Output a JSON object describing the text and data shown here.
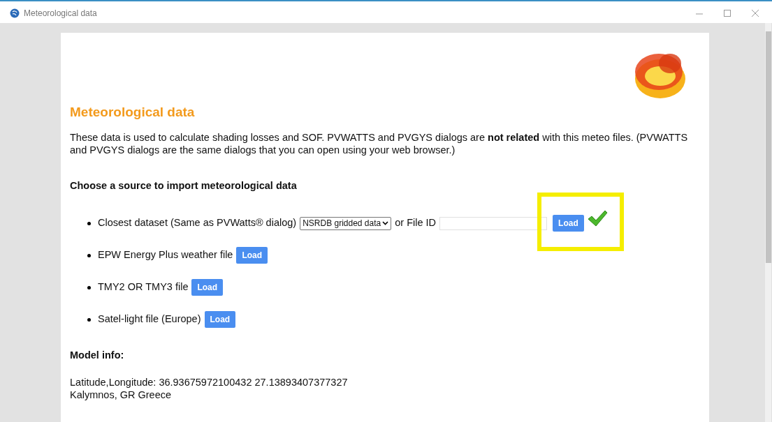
{
  "window": {
    "title": "Meteorological data"
  },
  "page": {
    "heading": "Meteorological data",
    "intro": "These data is used to calculate shading losses and SOF. PVWATTS and PVGYS dialogs are **not related** with this meteo files. (PVWATTS and PVGYS dialogs are the same dialogs that you can open using your web browser.)",
    "sources_heading": "Choose a source to import meteorological data",
    "sources": [
      {
        "kind": "dataset",
        "label": "Closest dataset (Same as PVWatts® dialog)",
        "select_value": "NSRDB gridded data",
        "separator": "or File ID",
        "button": "Load",
        "loaded": true,
        "highlighted": true
      },
      {
        "kind": "file",
        "label": "EPW Energy Plus weather file",
        "button": "Load"
      },
      {
        "kind": "file",
        "label": "TMY2 OR TMY3 file",
        "button": "Load"
      },
      {
        "kind": "file",
        "label": "Satel-light file (Europe)",
        "button": "Load"
      }
    ],
    "model_heading": "Model info:",
    "model_lines": [
      "Latitude,Longitude: 36.93675972100432 27.13893407377327",
      "Kalymnos, GR Greece"
    ]
  }
}
